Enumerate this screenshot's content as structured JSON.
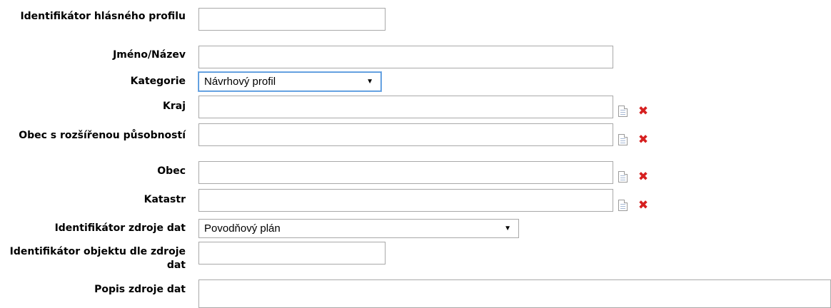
{
  "form": {
    "fields": {
      "profile_id": {
        "label": "Identifikátor hlásného profilu",
        "value": ""
      },
      "name": {
        "label": "Jméno/Název",
        "value": ""
      },
      "category": {
        "label": "Kategorie",
        "selected": "Návrhový profil"
      },
      "region": {
        "label": "Kraj",
        "value": ""
      },
      "municipality_ext": {
        "label": "Obec s rozšířenou působností",
        "value": ""
      },
      "municipality": {
        "label": "Obec",
        "value": ""
      },
      "cadastre": {
        "label": "Katastr",
        "value": ""
      },
      "data_source_id": {
        "label": "Identifikátor zdroje dat",
        "selected": "Povodňový plán"
      },
      "object_id": {
        "label": "Identifikátor objektu dle zdroje dat",
        "value": ""
      },
      "data_source_desc": {
        "label": "Popis zdroje dat",
        "value": ""
      }
    },
    "icons": {
      "select": "document-icon",
      "clear": "delete-x-icon"
    },
    "colors": {
      "clear_icon": "#d62020",
      "focus_border": "#4a90d9"
    }
  }
}
